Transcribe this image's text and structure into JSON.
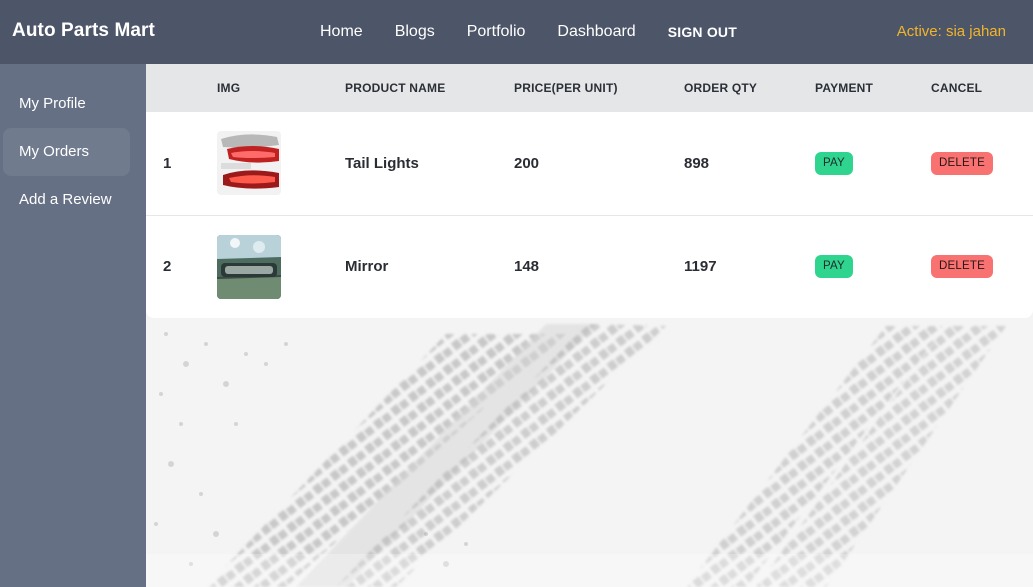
{
  "nav": {
    "brand": "Auto Parts Mart",
    "links": [
      "Home",
      "Blogs",
      "Portfolio",
      "Dashboard"
    ],
    "signout": "SIGN OUT",
    "active_user": "Active: sia jahan"
  },
  "sidebar": {
    "items": [
      {
        "label": "My Profile",
        "active": false
      },
      {
        "label": "My Orders",
        "active": true
      },
      {
        "label": "Add a Review",
        "active": false
      }
    ]
  },
  "orders": {
    "headers": [
      "",
      "IMG",
      "PRODUCT NAME",
      "PRICE(PER UNIT)",
      "ORDER QTY",
      "PAYMENT",
      "CANCEL"
    ],
    "rows": [
      {
        "index": "1",
        "image": "tail-lights-photo",
        "name": "Tail Lights",
        "price": "200",
        "qty": "898",
        "pay_label": "PAY",
        "delete_label": "DELETE"
      },
      {
        "index": "2",
        "image": "mirror-photo",
        "name": "Mirror",
        "price": "148",
        "qty": "1197",
        "pay_label": "PAY",
        "delete_label": "DELETE"
      }
    ]
  },
  "colors": {
    "navbar": "#4d5568",
    "sidebar": "#667085",
    "active_user": "#f1b52b",
    "pay_button": "#2fd58f",
    "delete_button": "#f87272"
  }
}
